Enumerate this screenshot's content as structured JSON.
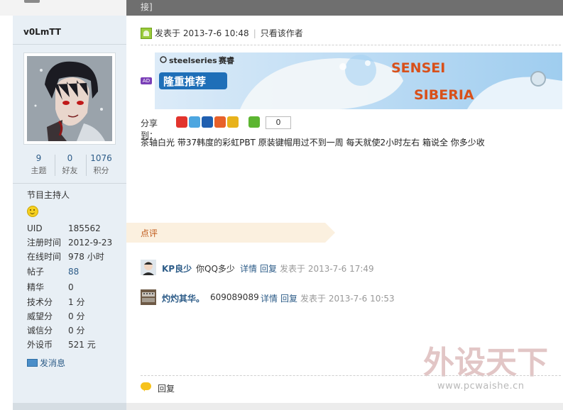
{
  "top": {
    "crumb_text": "接]"
  },
  "sidebar": {
    "username": "v0LmTT",
    "stats": [
      {
        "value": "9",
        "label": "主题"
      },
      {
        "value": "0",
        "label": "好友"
      },
      {
        "value": "1076",
        "label": "积分"
      }
    ],
    "rank": "节目主持人",
    "info": [
      {
        "key": "UID",
        "value": "185562"
      },
      {
        "key": "注册时间",
        "value": "2012-9-23"
      },
      {
        "key": "在线时间",
        "value": "978 小时"
      },
      {
        "key": "帖子",
        "value": "88"
      },
      {
        "key": "精华",
        "value": "0"
      },
      {
        "key": "技术分",
        "value": "1 分"
      },
      {
        "key": "威望分",
        "value": "0 分"
      },
      {
        "key": "诚信分",
        "value": "0 分"
      },
      {
        "key": "外设币",
        "value": "521 元"
      }
    ],
    "send_message": "发消息"
  },
  "post": {
    "posted_at": "发表于 2013-7-6 10:48",
    "author_only": "只看该作者",
    "ad_badge": "AD",
    "banner": {
      "brand": "steelseries",
      "brand_cn": "赛睿",
      "slogan": "隆重推荐",
      "product_1": "SENSEI",
      "product_2": "SIBERIA"
    },
    "share_label": "分享到：",
    "share_count": "0",
    "share_icons": [
      "weibo-icon",
      "qzone-icon",
      "renren-icon",
      "kaixin-icon",
      "douban-icon",
      "plus-icon"
    ],
    "body": "茶轴白光   带37韩度的彩虹PBT   原装键帽用过不到一周  每天就使2小时左右   箱说全   你多少收"
  },
  "comments": {
    "title": "点评",
    "items": [
      {
        "user": "KP良少",
        "text": "你QQ多少",
        "detail": "详情",
        "reply": "回复",
        "time": "发表于 2013-7-6 17:49"
      },
      {
        "user": "灼灼其华。",
        "text": "609089089",
        "detail": "详情",
        "reply": "回复",
        "time": "发表于 2013-7-6 10:53"
      }
    ]
  },
  "footer": {
    "reply": "回复"
  },
  "watermark": {
    "title": "外设天下",
    "site": "www.pcwaishe.cn"
  },
  "colors": {
    "link": "#2d5c88",
    "sidebar_bg": "#e8eff5",
    "comments_bar": "#fbf0df",
    "accent_orange": "#c05a1b"
  }
}
